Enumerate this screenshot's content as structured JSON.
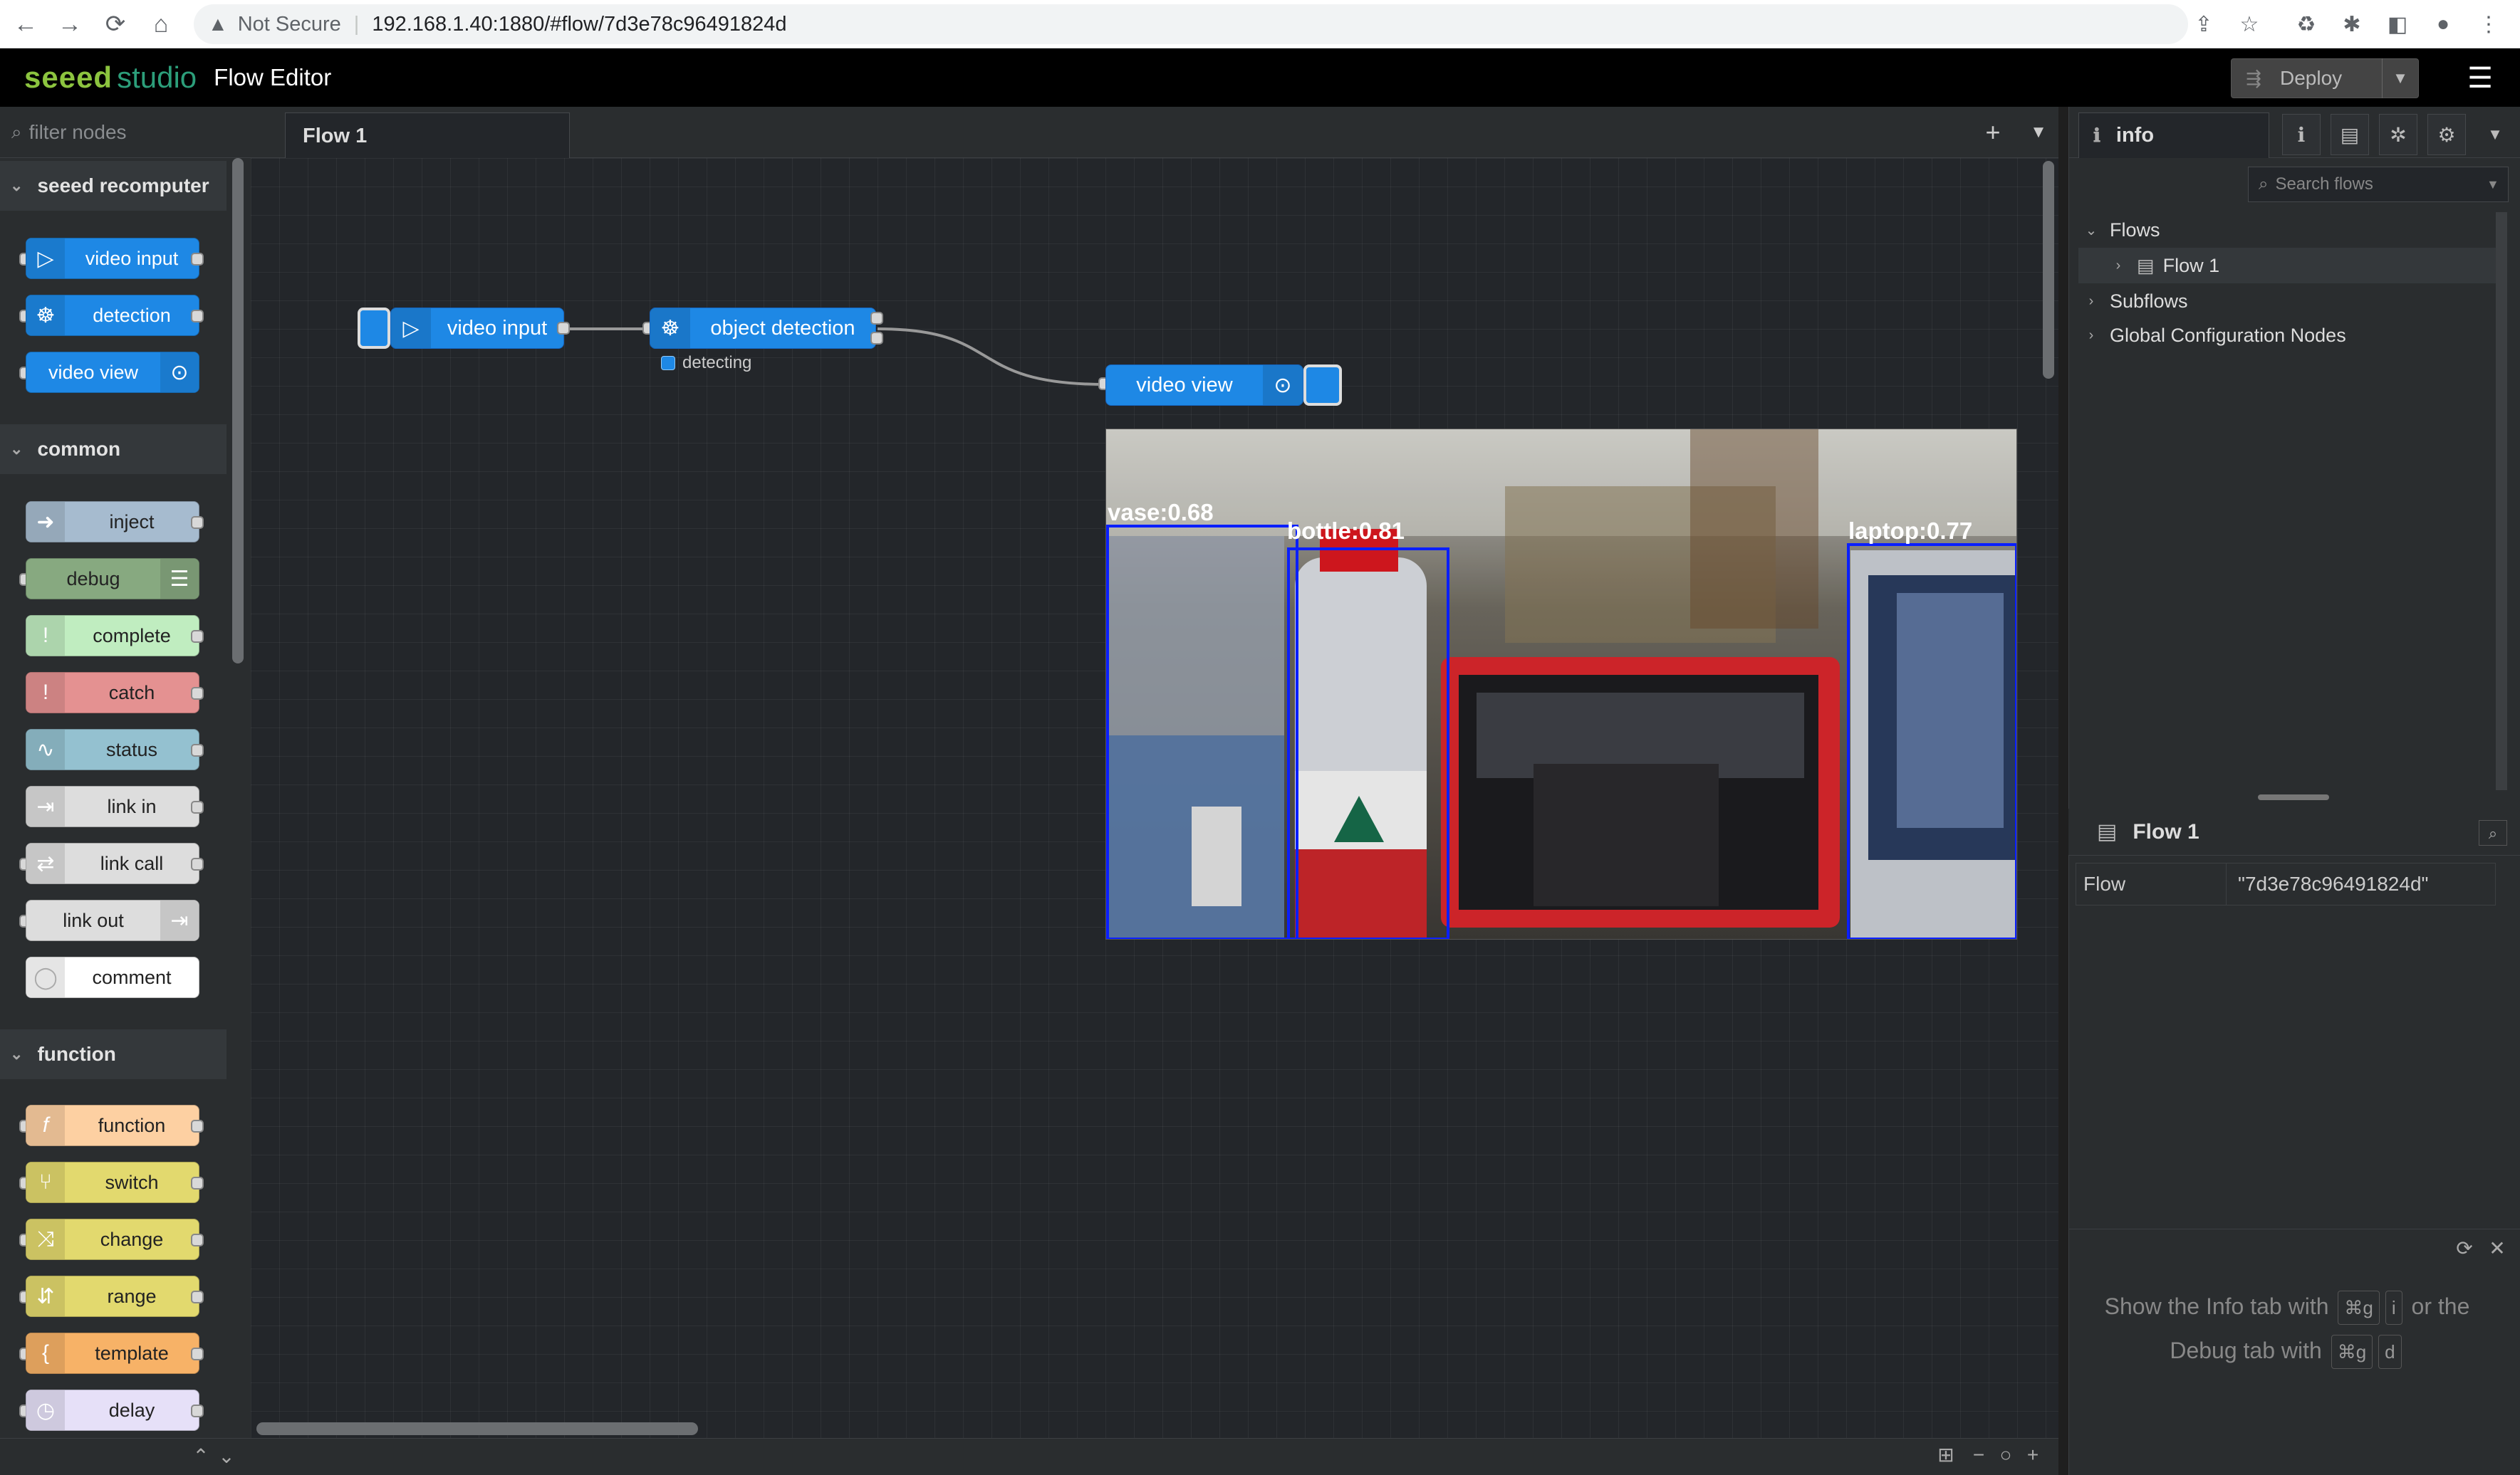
{
  "browser": {
    "security": "Not Secure",
    "url": "192.168.1.40:1880/#flow/7d3e78c96491824d"
  },
  "header": {
    "brand_a": "seeed",
    "brand_b": "studio",
    "title": "Flow Editor",
    "deploy_label": "Deploy"
  },
  "palette": {
    "filter_placeholder": "filter nodes",
    "categories": [
      {
        "name": "seeed recomputer"
      },
      {
        "name": "common"
      },
      {
        "name": "function"
      }
    ],
    "nodes": {
      "video_input": "video input",
      "detection": "detection",
      "video_view": "video view",
      "inject": "inject",
      "debug": "debug",
      "complete": "complete",
      "catch": "catch",
      "status": "status",
      "link_in": "link in",
      "link_call": "link call",
      "link_out": "link out",
      "comment": "comment",
      "function": "function",
      "switch": "switch",
      "change": "change",
      "range": "range",
      "template": "template",
      "delay": "delay"
    },
    "colors": {
      "seeed": "#1e88e5",
      "inject": "#a6bbcf",
      "debug": "#87a980",
      "complete": "#c0edc0",
      "catch": "#e49191",
      "status": "#94c1d0",
      "link": "#dddddd",
      "comment": "#ffffff",
      "function": "#fdd0a2",
      "switch": "#e2d96e",
      "template": "#f7b267",
      "delay": "#e6e0f8"
    }
  },
  "workspace": {
    "tab": "Flow 1",
    "nodes": {
      "video_input": "video input",
      "object_detection": "object detection",
      "status_text": "detecting",
      "video_view": "video view"
    },
    "detections": [
      {
        "label": "vase:0.68"
      },
      {
        "label": "bottle:0.81"
      },
      {
        "label": "laptop:0.77"
      }
    ]
  },
  "sidebar": {
    "tab": "info",
    "search_placeholder": "Search flows",
    "tree": {
      "flows": "Flows",
      "flow1": "Flow 1",
      "subflows": "Subflows",
      "global": "Global Configuration Nodes"
    },
    "selected_title": "Flow 1",
    "prop_key": "Flow",
    "prop_value": "\"7d3e78c96491824d\"",
    "help": {
      "a": "Show the Info tab with",
      "k1": "⌘g",
      "k2": "i",
      "b": "or the",
      "c": "Debug tab with",
      "k3": "⌘g",
      "k4": "d"
    }
  }
}
